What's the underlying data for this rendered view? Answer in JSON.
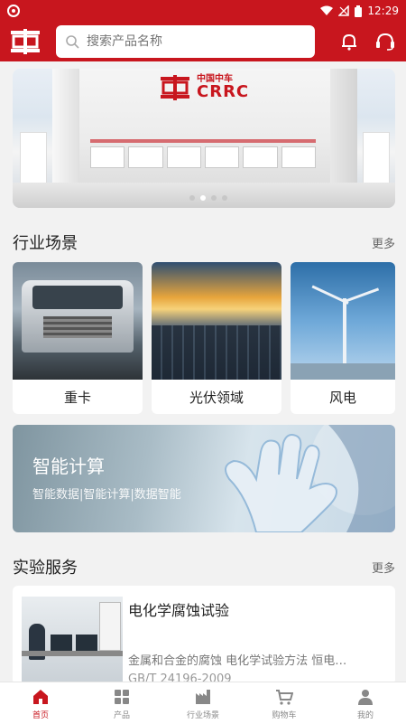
{
  "status_bar": {
    "time": "12:29"
  },
  "search": {
    "placeholder": "搜索产品名称"
  },
  "banner": {
    "brand_cn": "中国中车",
    "brand_en": "CRRC",
    "slide_count": 4,
    "active_slide": 2
  },
  "industry": {
    "title": "行业场景",
    "more": "更多",
    "items": [
      {
        "label": "重卡"
      },
      {
        "label": "光伏领域"
      },
      {
        "label": "风电"
      }
    ]
  },
  "smart": {
    "title": "智能计算",
    "subtitle": "智能数据|智能计算|数据智能"
  },
  "lab": {
    "title": "实验服务",
    "more": "更多",
    "card": {
      "title": "电化学腐蚀试验",
      "desc": "金属和合金的腐蚀 电化学试验方法 恒电…",
      "standard": "GB/T 24196-2009"
    }
  },
  "bottom_nav": [
    {
      "label": "首页",
      "icon": "home-icon",
      "active": true
    },
    {
      "label": "产品",
      "icon": "grid-icon",
      "active": false
    },
    {
      "label": "行业场景",
      "icon": "factory-icon",
      "active": false
    },
    {
      "label": "购物车",
      "icon": "cart-icon",
      "active": false
    },
    {
      "label": "我的",
      "icon": "user-icon",
      "active": false
    }
  ],
  "colors": {
    "brand_red": "#c8161e"
  }
}
